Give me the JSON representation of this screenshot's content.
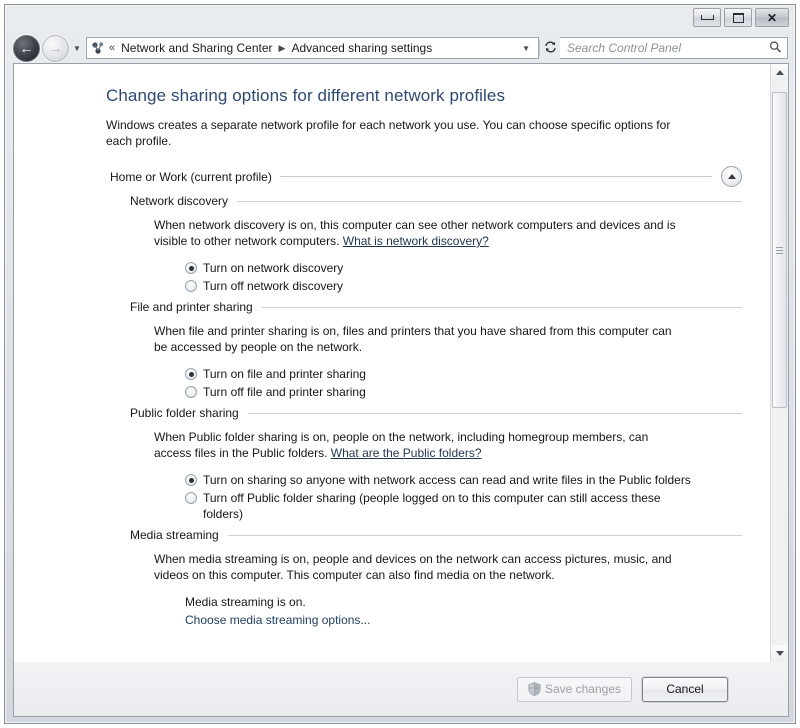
{
  "window": {
    "buttons": {
      "minimize": "minimize",
      "maximize": "maximize",
      "close": "✕"
    }
  },
  "nav": {
    "back": "←",
    "forward": "→",
    "recent_caret": "▼",
    "overflow_chevrons": "«",
    "breadcrumbs": [
      "Network and Sharing Center",
      "Advanced sharing settings"
    ],
    "separator": "▶",
    "address_caret": "▼",
    "refresh": "↯",
    "search": {
      "placeholder": "Search Control Panel",
      "value": "",
      "icon": "search-icon"
    }
  },
  "page": {
    "title": "Change sharing options for different network profiles",
    "intro": "Windows creates a separate network profile for each network you use. You can choose specific options for each profile.",
    "profile": {
      "label": "Home or Work (current profile)",
      "collapsed": false,
      "collapse_icon": "chevron-up-icon"
    },
    "sections": [
      {
        "title": "Network discovery",
        "desc_before_link": "When network discovery is on, this computer can see other network computers and devices and is visible to other network computers. ",
        "link": "What is network discovery?",
        "desc_after_link": "",
        "options": [
          {
            "label": "Turn on network discovery",
            "checked": true
          },
          {
            "label": "Turn off network discovery",
            "checked": false
          }
        ]
      },
      {
        "title": "File and printer sharing",
        "desc_before_link": "When file and printer sharing is on, files and printers that you have shared from this computer can be accessed by people on the network.",
        "link": "",
        "desc_after_link": "",
        "options": [
          {
            "label": "Turn on file and printer sharing",
            "checked": true
          },
          {
            "label": "Turn off file and printer sharing",
            "checked": false
          }
        ]
      },
      {
        "title": "Public folder sharing",
        "desc_before_link": "When Public folder sharing is on, people on the network, including homegroup members, can access files in the Public folders. ",
        "link": "What are the Public folders?",
        "desc_after_link": "",
        "options": [
          {
            "label": "Turn on sharing so anyone with network access can read and write files in the Public folders",
            "checked": true
          },
          {
            "label": "Turn off Public folder sharing (people logged on to this computer can still access these folders)",
            "checked": false
          }
        ]
      },
      {
        "title": "Media streaming",
        "desc_before_link": "When media streaming is on, people and devices on the network can access pictures, music, and videos on this computer. This computer can also find media on the network.",
        "link": "",
        "desc_after_link": "",
        "status_text": "Media streaming is on.",
        "status_link": "Choose media streaming options..."
      }
    ]
  },
  "footer": {
    "save_label": "Save changes",
    "save_enabled": false,
    "save_icon": "uac-shield-icon",
    "cancel_label": "Cancel"
  },
  "scrollbar": {
    "up_arrow": "▲",
    "down_arrow": "▼",
    "thumb_top_percent": 2,
    "thumb_height_percent": 56
  },
  "colors": {
    "title_blue": "#2c4a73",
    "link": "#1d3b5e",
    "text": "#14171a",
    "rule": "#c9ced3"
  }
}
